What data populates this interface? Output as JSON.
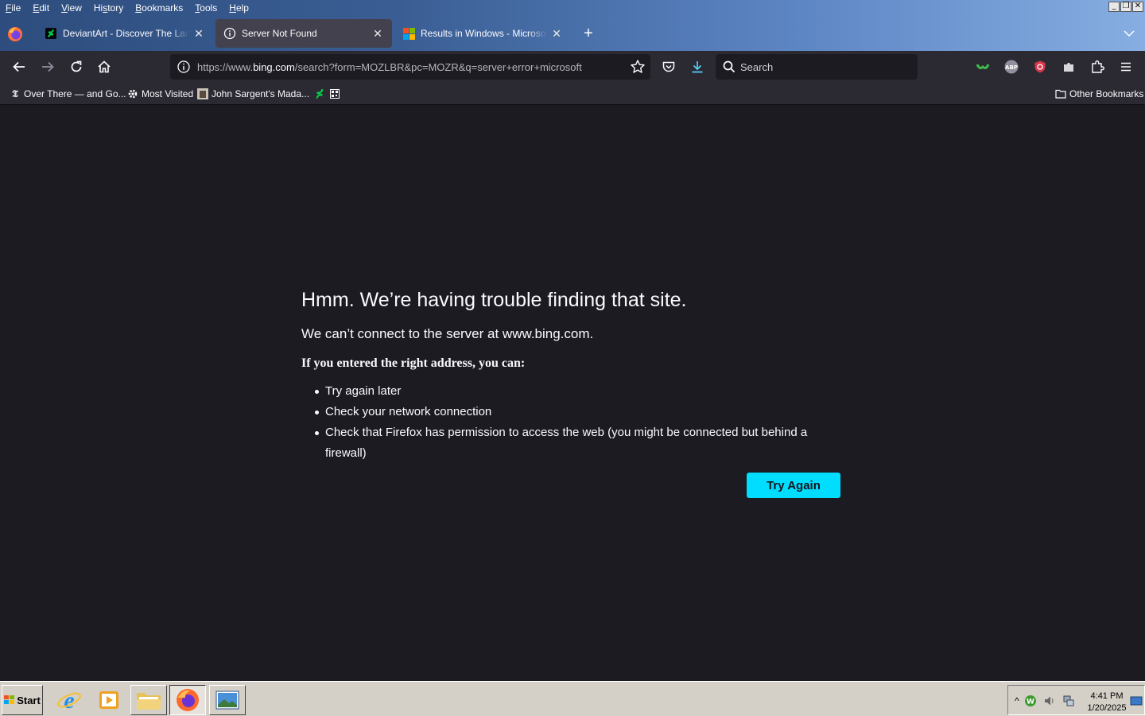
{
  "menubar": {
    "items": [
      {
        "label": "File",
        "key": "F"
      },
      {
        "label": "Edit",
        "key": "E"
      },
      {
        "label": "View",
        "key": "V"
      },
      {
        "label": "History",
        "key": "s"
      },
      {
        "label": "Bookmarks",
        "key": "B"
      },
      {
        "label": "Tools",
        "key": "T"
      },
      {
        "label": "Help",
        "key": "H"
      }
    ]
  },
  "tabs": [
    {
      "title": "DeviantArt - Discover The Largest",
      "icon": "deviantart-icon",
      "selected": false
    },
    {
      "title": "Server Not Found",
      "icon": "info-icon",
      "selected": true
    },
    {
      "title": "Results in Windows - Microsoft Com",
      "icon": "microsoft-icon",
      "selected": false
    }
  ],
  "urlbar": {
    "prefix": "https://www.",
    "host": "bing.com",
    "path": "/search?form=MOZLBR&pc=MOZR&q=server+error+microsoft"
  },
  "searchbar": {
    "placeholder": "Search"
  },
  "bookmarks": {
    "items": [
      {
        "label": "Over There — and Go...",
        "icon": "nyt-icon"
      },
      {
        "label": "Most Visited",
        "icon": "gear-icon"
      },
      {
        "label": "John Sargent's Mada...",
        "icon": "image-thumb-icon"
      },
      {
        "label": "",
        "icon": "deviantart-icon"
      },
      {
        "label": "",
        "icon": "qr-icon"
      }
    ],
    "other": "Other Bookmarks"
  },
  "error": {
    "title": "Hmm. We’re having trouble finding that site.",
    "description": "We can’t connect to the server at www.bing.com.",
    "subtitle": "If you entered the right address, you can:",
    "suggestions": [
      "Try again later",
      "Check your network connection",
      "Check that Firefox has permission to access the web (you might be connected but behind a firewall)"
    ],
    "button": "Try Again"
  },
  "taskbar": {
    "start_label": "Start",
    "clock_time": "4:41 PM",
    "clock_date": "1/20/2025"
  },
  "colors": {
    "accent": "#00ddff",
    "page_bg": "#1c1b22",
    "toolbar_bg": "#2b2a33",
    "selected_tab_bg": "#42414d"
  }
}
